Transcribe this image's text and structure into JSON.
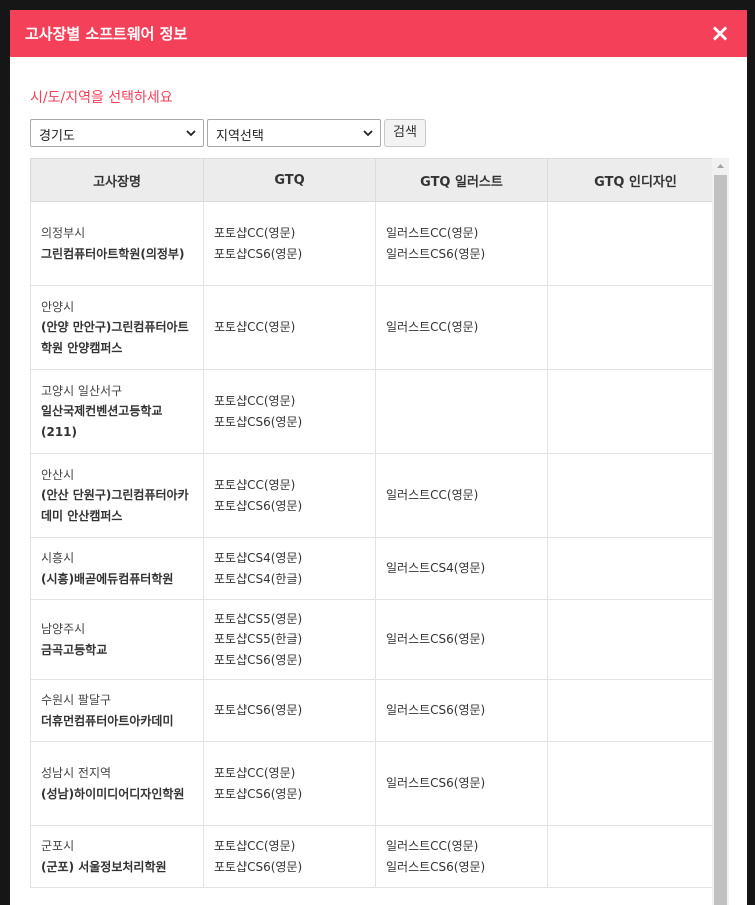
{
  "modal": {
    "title": "고사장별 소프트웨어 정보",
    "close_icon": "×"
  },
  "filters": {
    "prompt": "시/도/지역을 선택하세요",
    "province_value": "경기도",
    "region_value": "지역선택",
    "search_label": "검색"
  },
  "table": {
    "headers": [
      "고사장명",
      "GTQ",
      "GTQ 일러스트",
      "GTQ 인디자인"
    ],
    "rows": [
      {
        "region": "의정부시",
        "school": "그린컴퓨터아트학원(의정부)",
        "gtq": [
          "포토샵CC(영문)",
          "포토샵CS6(영문)"
        ],
        "illust": [
          "일러스트CC(영문)",
          "일러스트CS6(영문)"
        ],
        "indesign": []
      },
      {
        "region": "안양시",
        "school": "(안양 만안구)그린컴퓨터아트학원 안양캠퍼스",
        "gtq": [
          "포토샵CC(영문)"
        ],
        "illust": [
          "일러스트CC(영문)"
        ],
        "indesign": []
      },
      {
        "region": "고양시 일산서구",
        "school": "일산국제컨벤션고등학교(211)",
        "gtq": [
          "포토샵CC(영문)",
          "포토샵CS6(영문)"
        ],
        "illust": [],
        "indesign": []
      },
      {
        "region": "안산시",
        "school": "(안산 단원구)그린컴퓨터아카데미 안산캠퍼스",
        "gtq": [
          "포토샵CC(영문)",
          "포토샵CS6(영문)"
        ],
        "illust": [
          "일러스트CC(영문)"
        ],
        "indesign": []
      },
      {
        "region": "시흥시",
        "school": "(시흥)배곧에듀컴퓨터학원",
        "gtq": [
          "포토샵CS4(영문)",
          "포토샵CS4(한글)"
        ],
        "illust": [
          "일러스트CS4(영문)"
        ],
        "indesign": []
      },
      {
        "region": "남양주시",
        "school": "금곡고등학교",
        "gtq": [
          "포토샵CS5(영문)",
          "포토샵CS5(한글)",
          "포토샵CS6(영문)"
        ],
        "illust": [
          "일러스트CS6(영문)"
        ],
        "indesign": []
      },
      {
        "region": "수원시 팔달구",
        "school": "더휴먼컴퓨터아트아카데미",
        "gtq": [
          "포토샵CS6(영문)"
        ],
        "illust": [
          "일러스트CS6(영문)"
        ],
        "indesign": []
      },
      {
        "region": "성남시 전지역",
        "school": "(성남)하이미디어디자인학원",
        "gtq": [
          "포토샵CC(영문)",
          "포토샵CS6(영문)"
        ],
        "illust": [
          "일러스트CS6(영문)"
        ],
        "indesign": []
      },
      {
        "region": "군포시",
        "school": "(군포) 서울정보처리학원",
        "gtq": [
          "포토샵CC(영문)",
          "포토샵CS6(영문)"
        ],
        "illust": [
          "일러스트CC(영문)",
          "일러스트CS6(영문)"
        ],
        "indesign": []
      }
    ]
  },
  "icons": {
    "close": "close-icon",
    "dropdown": "chevron-down-icon",
    "scroll_up": "triangle-up-icon"
  },
  "colors": {
    "accent": "#f5405a",
    "header_bg": "#ececec"
  }
}
